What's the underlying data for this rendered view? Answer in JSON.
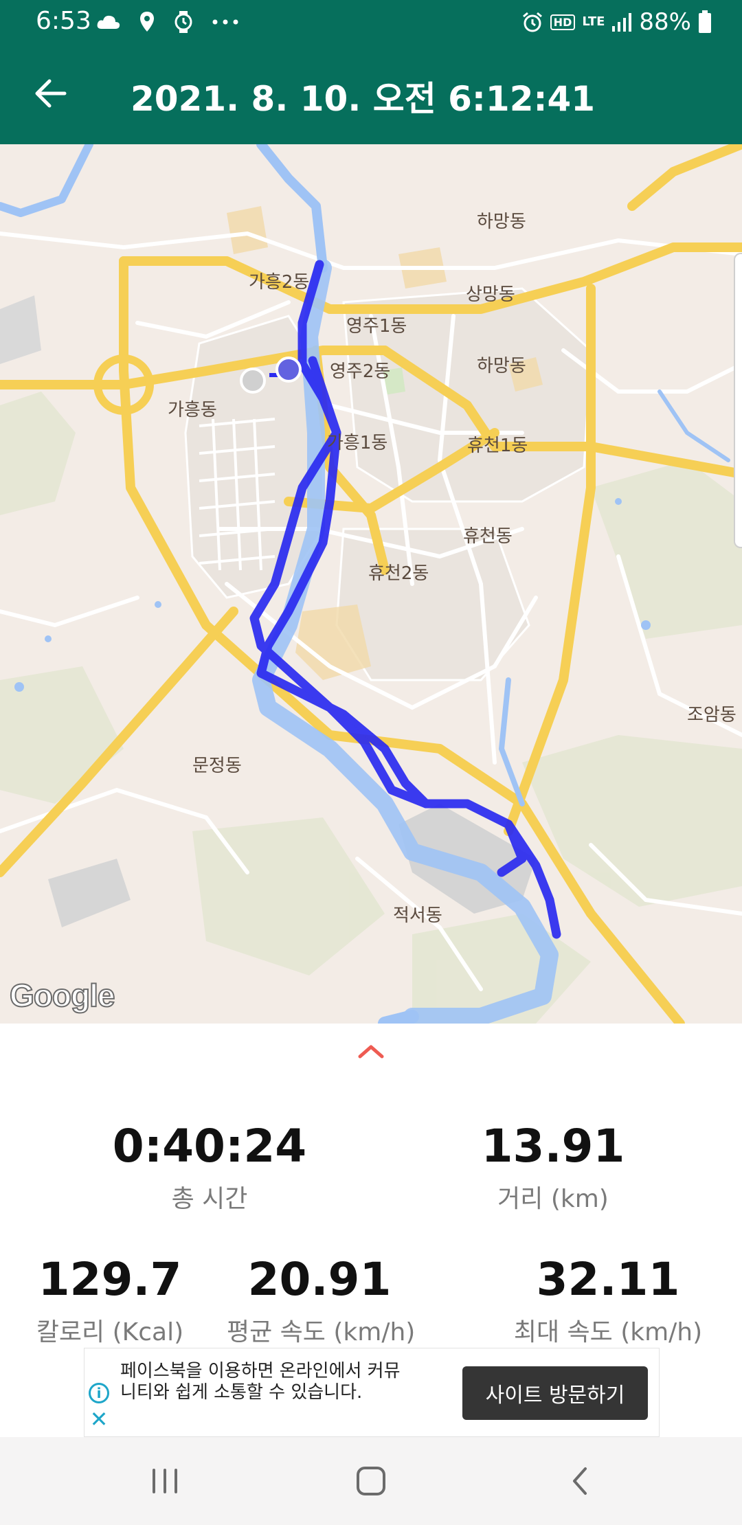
{
  "status_bar": {
    "time": "6:53",
    "battery_percent": "88%",
    "icons": [
      "cloud-icon",
      "location-icon",
      "watch-icon",
      "more-icon",
      "alarm-icon",
      "hd-icon",
      "lte-icon",
      "signal-icon",
      "battery-icon"
    ],
    "hd_label": "HD",
    "lte_label": "LTE"
  },
  "app_bar": {
    "title": "2021. 8. 10. 오전 6:12:41",
    "back_icon": "arrow-left-icon"
  },
  "map": {
    "labels": [
      "하망동",
      "가흥2동",
      "상망동",
      "영주1동",
      "영주2동",
      "하망동",
      "가흥동",
      "가흥1동",
      "휴천1동",
      "휴천동",
      "휴천2동",
      "조암동",
      "문정동",
      "적서동"
    ],
    "logo": "Google",
    "route_color": "#2b2bf0",
    "river_color": "#9fc3f5",
    "road_color": "#f6cf55"
  },
  "stats": {
    "expand_icon": "chevron-up-icon",
    "total_time": {
      "value": "0:40:24",
      "label": "총 시간"
    },
    "distance": {
      "value": "13.91",
      "label": "거리 (km)"
    },
    "calories": {
      "value": "129.7",
      "label": "칼로리 (Kcal)"
    },
    "avg_speed": {
      "value": "20.91",
      "label": "평균 속도 (km/h)"
    },
    "max_speed": {
      "value": "32.11",
      "label": "최대 속도 (km/h)"
    }
  },
  "ad": {
    "text": "페이스북을 이용하면 온라인에서 커뮤니티와 쉽게 소통할 수 있습니다.",
    "button_label": "사이트 방문하기"
  },
  "nav_bar": {
    "icons": [
      "recent-apps-icon",
      "home-icon",
      "back-icon"
    ]
  }
}
